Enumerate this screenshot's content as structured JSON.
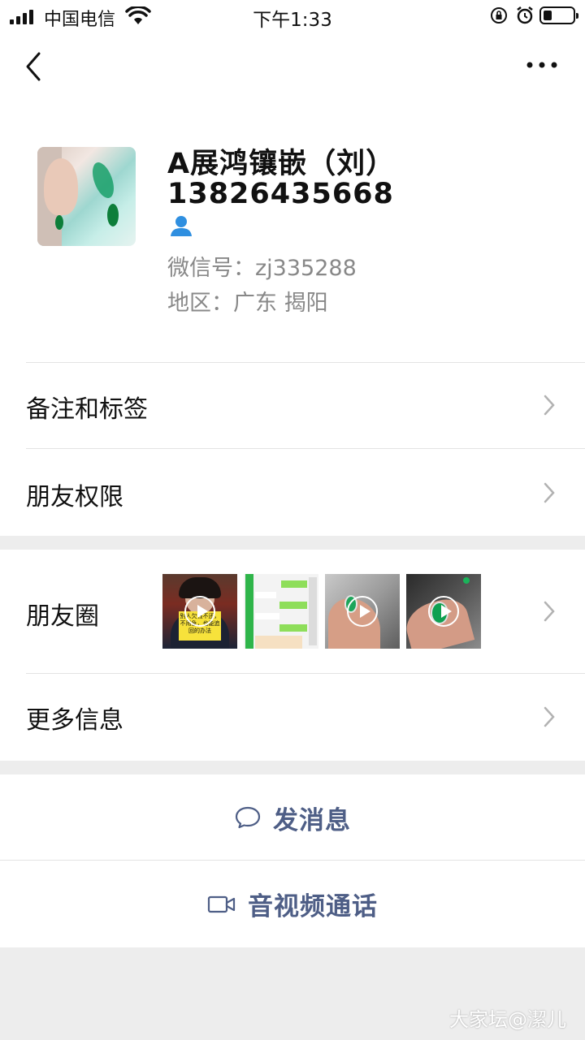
{
  "status_bar": {
    "carrier": "中国电信",
    "time": "下午1:33",
    "icons": [
      "signal-icon",
      "wifi-icon",
      "orientation-lock-icon",
      "alarm-icon",
      "battery-icon"
    ]
  },
  "nav": {
    "back_icon": "back-chevron-icon",
    "more_icon": "more-dots-icon"
  },
  "profile": {
    "name": "A展鸿镶嵌（刘）",
    "phone": "13826435668",
    "wechat_id": "微信号：zj335288",
    "region": "地区：广东 揭阳"
  },
  "menu": {
    "remarks_tags": "备注和标签",
    "friend_permissions": "朋友权限",
    "moments": "朋友圈",
    "more_info": "更多信息"
  },
  "moments_thumbs": {
    "video1_caption": "别人欠钱不还，不用急，也能追回的办法"
  },
  "actions": {
    "send_message": "发消息",
    "av_call": "音视频通话"
  },
  "watermark": "大家坛@潔儿",
  "colors": {
    "accent": "#4e5e86",
    "background": "#ededed",
    "cell": "#ffffff",
    "secondary_text": "#888888"
  }
}
